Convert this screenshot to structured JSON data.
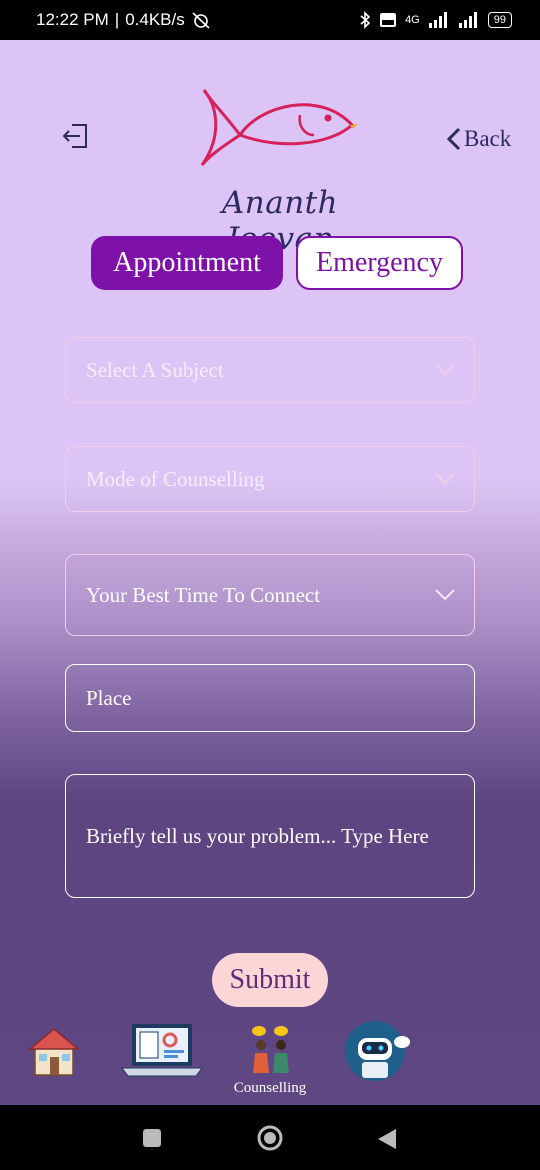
{
  "status_bar": {
    "time": "12:22 PM",
    "separator": "|",
    "speed": "0.4KB/s",
    "network_label": "4G",
    "battery": "99"
  },
  "header": {
    "brand": "Ananth Jeevan",
    "back_label": "Back"
  },
  "tabs": [
    {
      "label": "Appointment",
      "active": true
    },
    {
      "label": "Emergency",
      "active": false
    }
  ],
  "form": {
    "subject_placeholder": "Select A Subject",
    "mode_placeholder": "Mode of Counselling",
    "time_placeholder": "Your Best Time To Connect",
    "place_placeholder": "Place",
    "problem_placeholder": "Briefly tell us your problem...   Type Here",
    "submit_label": "Submit"
  },
  "bottom_nav": {
    "counselling_label": "Counselling",
    "items": [
      "home-icon",
      "assessment-laptop-icon",
      "counselling-icon",
      "chatbot-icon"
    ]
  },
  "colors": {
    "accent_purple": "#7e12a8",
    "brand_navy": "#2d2a5e",
    "submit_bg": "#fcd6d6"
  }
}
